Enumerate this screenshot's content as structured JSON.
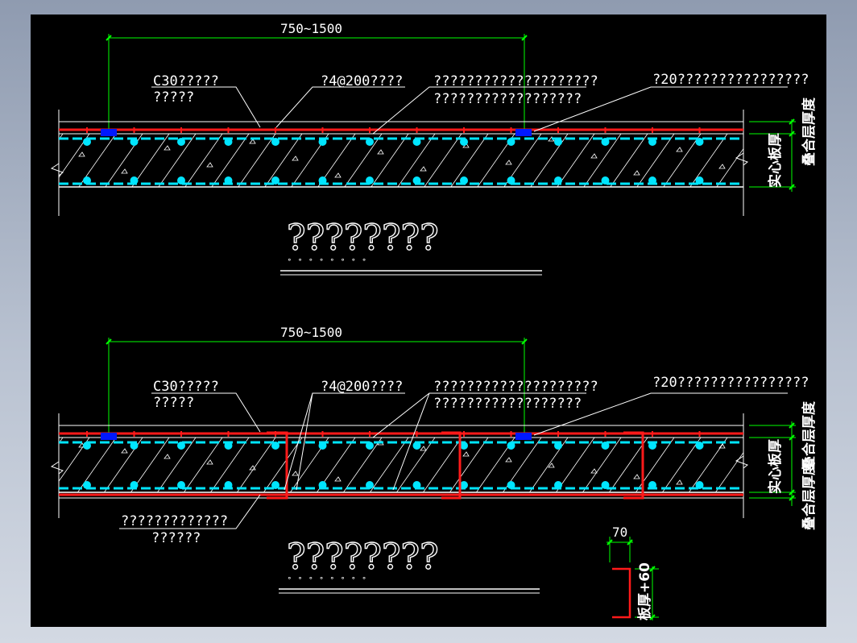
{
  "colors": {
    "background": "#000000",
    "dimension": "#00ff00",
    "rebar_red": "#ff1a1a",
    "rebar_cyan": "#00e5ff",
    "insert_blue": "#0018ff",
    "line_white": "#ffffff",
    "window_bg": "#a9b3c4"
  },
  "section1": {
    "span_dim": "750~1500",
    "label_concrete_1": "C30?????",
    "label_concrete_2": "?????",
    "label_rebar": "?4@200????",
    "label_mesh_1": "????????????????????",
    "label_mesh_2": "??????????????????",
    "label_insert": "?20????????????????",
    "vlabel_solid": "实心板厚",
    "vlabel_layer": "叠合层厚度",
    "caption": "????????"
  },
  "section2": {
    "span_dim": "750~1500",
    "label_concrete_1": "C30?????",
    "label_concrete_2": "?????",
    "label_rebar": "?4@200????",
    "label_mesh_1": "????????????????????",
    "label_mesh_2": "??????????????????",
    "label_insert": "?20????????????????",
    "label_bottom_1": "?????????????",
    "label_bottom_2": "??????",
    "vlabel_solid": "实心板厚",
    "vlabel_layer_top": "叠合层厚度",
    "vlabel_layer_bottom": "叠合层厚度",
    "caption": "????????"
  },
  "detail": {
    "width_dim": "70",
    "height_label": "板厚+60"
  }
}
